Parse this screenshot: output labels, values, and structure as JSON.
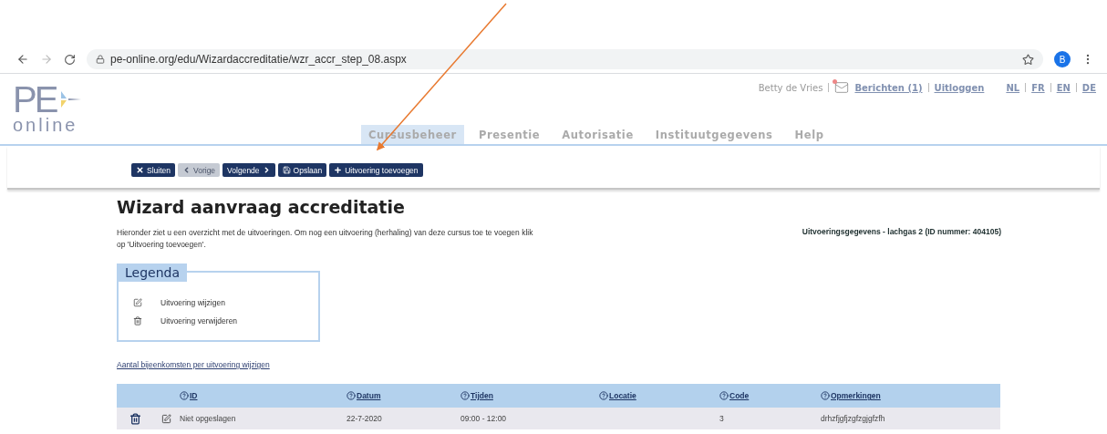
{
  "browser": {
    "url": "pe-online.org/edu/Wizardaccreditatie/wzr_accr_step_08.aspx",
    "avatar": "B"
  },
  "logo": {
    "title": "PE",
    "subtitle": "online"
  },
  "user_bar": {
    "user": "Betty de Vries",
    "messages": "Berichten (1)",
    "logout": "Uitloggen",
    "languages": [
      "NL",
      "FR",
      "EN",
      "DE"
    ]
  },
  "nav_tabs": [
    {
      "label": "Cursusbeheer",
      "selected": true
    },
    {
      "label": "Presentie",
      "selected": false
    },
    {
      "label": "Autorisatie",
      "selected": false
    },
    {
      "label": "Instituutgegevens",
      "selected": false
    },
    {
      "label": "Help",
      "selected": false
    }
  ],
  "toolbar": [
    {
      "label": "Sluiten",
      "kind": "close",
      "disabled": false
    },
    {
      "label": "Vorige",
      "kind": "prev",
      "disabled": true
    },
    {
      "label": "Volgende",
      "kind": "next",
      "disabled": false
    },
    {
      "label": "Opslaan",
      "kind": "save",
      "disabled": false
    },
    {
      "label": "Uitvoering toevoegen",
      "kind": "add",
      "disabled": false
    }
  ],
  "title": "Wizard aanvraag accreditatie",
  "intro": "Hieronder ziet u een overzicht met de uitvoeringen. Om nog een uitvoering (herhaling) van deze cursus toe te voegen klik op 'Uitvoering toevoegen'.",
  "details": "Uitvoeringsgegevens - lachgas 2 (ID nummer: 404105)",
  "legend": {
    "title": "Legenda",
    "items": [
      {
        "kind": "edit",
        "label": "Uitvoering wijzigen"
      },
      {
        "kind": "delete",
        "label": "Uitvoering verwijderen"
      }
    ]
  },
  "meetings_link": "Aantal bijeenkomsten per uitvoering wijzigen",
  "table": {
    "columns": [
      "ID",
      "Datum",
      "Tijden",
      "Locatie",
      "Code",
      "Opmerkingen"
    ],
    "rows": [
      {
        "cells": [
          "Niet opgeslagen",
          "22-7-2020",
          "09:00 - 12:00",
          null,
          "3",
          "drhzfjgfjzgfzgjgfzfh"
        ]
      }
    ]
  }
}
